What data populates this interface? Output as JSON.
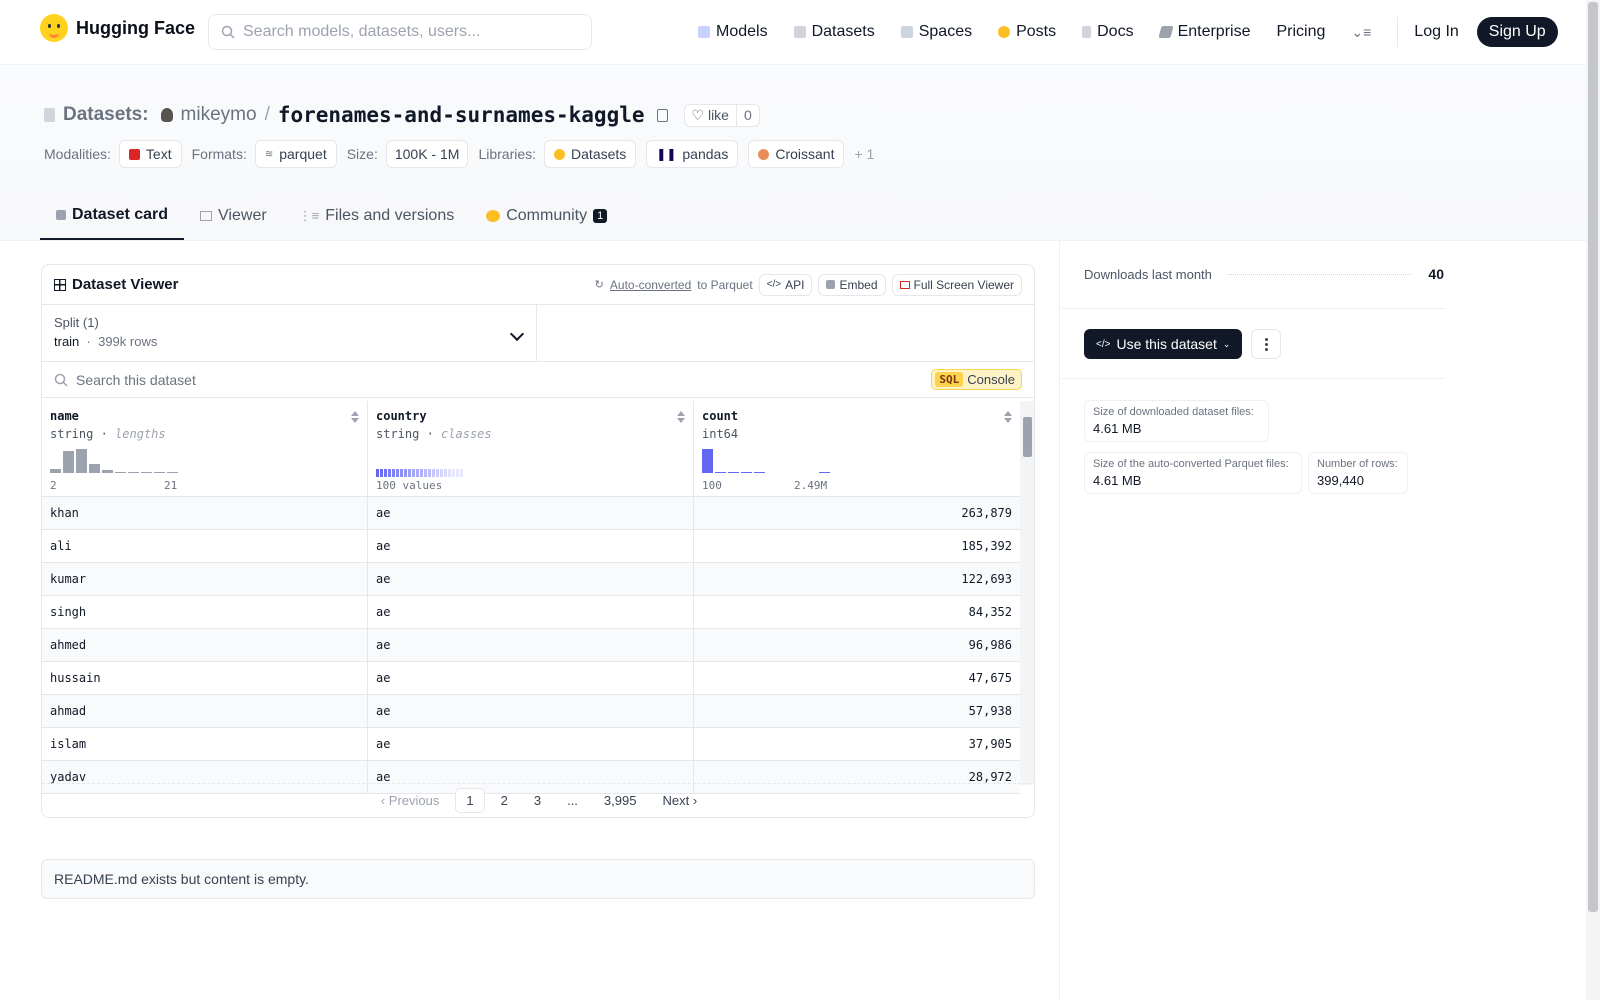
{
  "nav": {
    "brand": "Hugging Face",
    "search_placeholder": "Search models, datasets, users...",
    "links": [
      "Models",
      "Datasets",
      "Spaces",
      "Posts",
      "Docs",
      "Enterprise",
      "Pricing"
    ],
    "login": "Log In",
    "signup": "Sign Up"
  },
  "header": {
    "section": "Datasets:",
    "owner": "mikeymo",
    "repo": "forenames-and-surnames-kaggle",
    "like_label": "like",
    "like_count": "0",
    "modalities_label": "Modalities:",
    "modality": "Text",
    "formats_label": "Formats:",
    "format": "parquet",
    "size_label": "Size:",
    "size": "100K - 1M",
    "libraries_label": "Libraries:",
    "libraries": [
      "Datasets",
      "pandas",
      "Croissant"
    ],
    "more": "+ 1",
    "tabs": [
      "Dataset card",
      "Viewer",
      "Files and versions",
      "Community"
    ],
    "community_count": "1"
  },
  "viewer": {
    "title": "Dataset Viewer",
    "auto_converted": "Auto-converted",
    "to_parquet": "to Parquet",
    "api": "API",
    "embed": "Embed",
    "fullscreen": "Full Screen Viewer",
    "split_label": "Split (1)",
    "split_name": "train",
    "split_rows": "399k rows",
    "search_placeholder": "Search this dataset",
    "sql": "SQL",
    "console": "Console",
    "columns": [
      {
        "name": "name",
        "type": "string",
        "note": "lengths",
        "min": "2",
        "max": "21"
      },
      {
        "name": "country",
        "type": "string",
        "note": "classes",
        "summary": "100 values"
      },
      {
        "name": "count",
        "type": "int64",
        "min": "100",
        "max": "2.49M"
      }
    ],
    "rows": [
      {
        "name": "khan",
        "country": "ae",
        "count": "263,879"
      },
      {
        "name": "ali",
        "country": "ae",
        "count": "185,392"
      },
      {
        "name": "kumar",
        "country": "ae",
        "count": "122,693"
      },
      {
        "name": "singh",
        "country": "ae",
        "count": "84,352"
      },
      {
        "name": "ahmed",
        "country": "ae",
        "count": "96,986"
      },
      {
        "name": "hussain",
        "country": "ae",
        "count": "47,675"
      },
      {
        "name": "ahmad",
        "country": "ae",
        "count": "57,938"
      },
      {
        "name": "islam",
        "country": "ae",
        "count": "37,905"
      },
      {
        "name": "yadav",
        "country": "ae",
        "count": "28,972"
      }
    ],
    "pager": {
      "prev": "Previous",
      "pages": [
        "1",
        "2",
        "3",
        "...",
        "3,995"
      ],
      "next": "Next"
    }
  },
  "readme": "README.md exists but content is empty.",
  "sidebar": {
    "downloads_label": "Downloads last month",
    "downloads": "40",
    "use_button": "Use this dataset",
    "stats": [
      {
        "label": "Size of downloaded dataset files:",
        "value": "4.61 MB"
      },
      {
        "label": "Size of the auto-converted Parquet files:",
        "value": "4.61 MB"
      },
      {
        "label": "Number of rows:",
        "value": "399,440"
      }
    ]
  },
  "colors": {
    "accent": "#6366f1",
    "dark": "#111827",
    "hf_yellow": "#ffd21e"
  }
}
